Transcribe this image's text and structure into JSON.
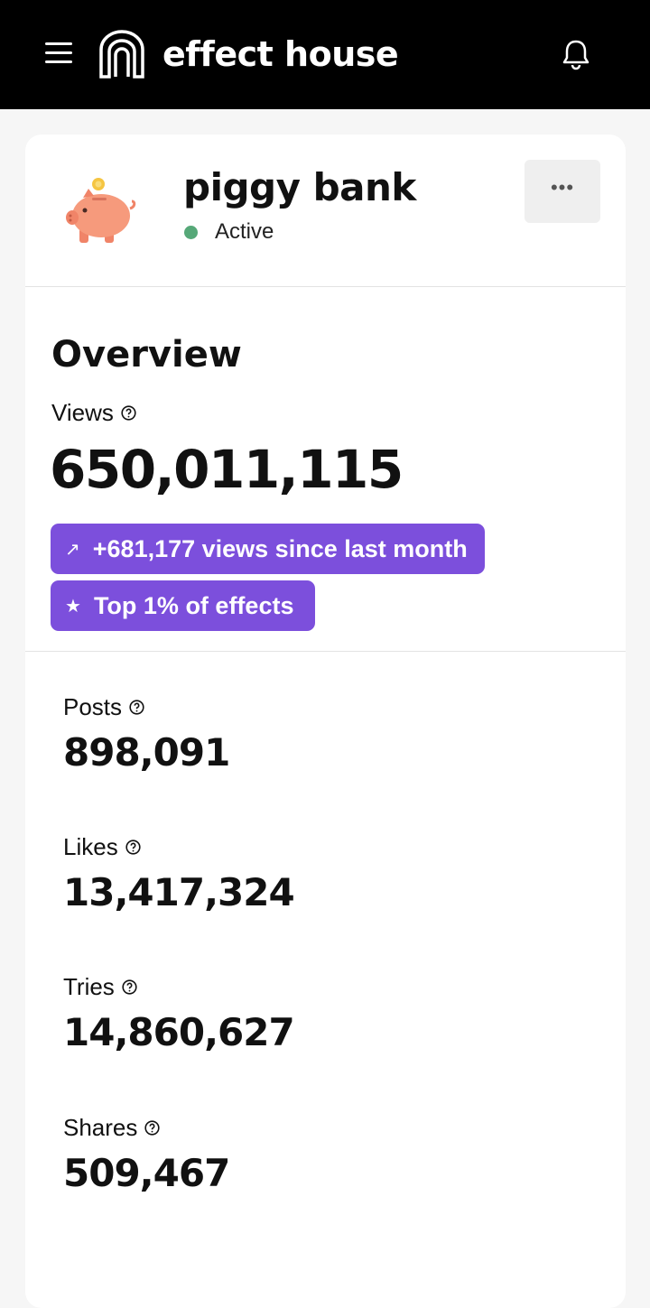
{
  "app": {
    "brand": "effect house"
  },
  "icons": {
    "menu": "menu-icon",
    "bell": "bell-icon",
    "help": "help-icon",
    "more": "more-icon",
    "trend": "arrow-up-right-icon",
    "star": "star-icon"
  },
  "effect": {
    "name": "piggy bank",
    "status": "Active",
    "status_color": "#56a878",
    "more_label": "•••"
  },
  "overview": {
    "title": "Overview",
    "views_label": "Views",
    "views_value": "650,011,115",
    "trend_icon": "↗",
    "trend_text": "+681,177 views since last month",
    "rank_icon": "★",
    "rank_text": "Top 1% of effects",
    "accent_color": "#7c4fdc"
  },
  "stats": [
    {
      "label": "Posts",
      "value": "898,091"
    },
    {
      "label": "Likes",
      "value": "13,417,324"
    },
    {
      "label": "Tries",
      "value": "14,860,627"
    },
    {
      "label": "Shares",
      "value": "509,467"
    }
  ]
}
